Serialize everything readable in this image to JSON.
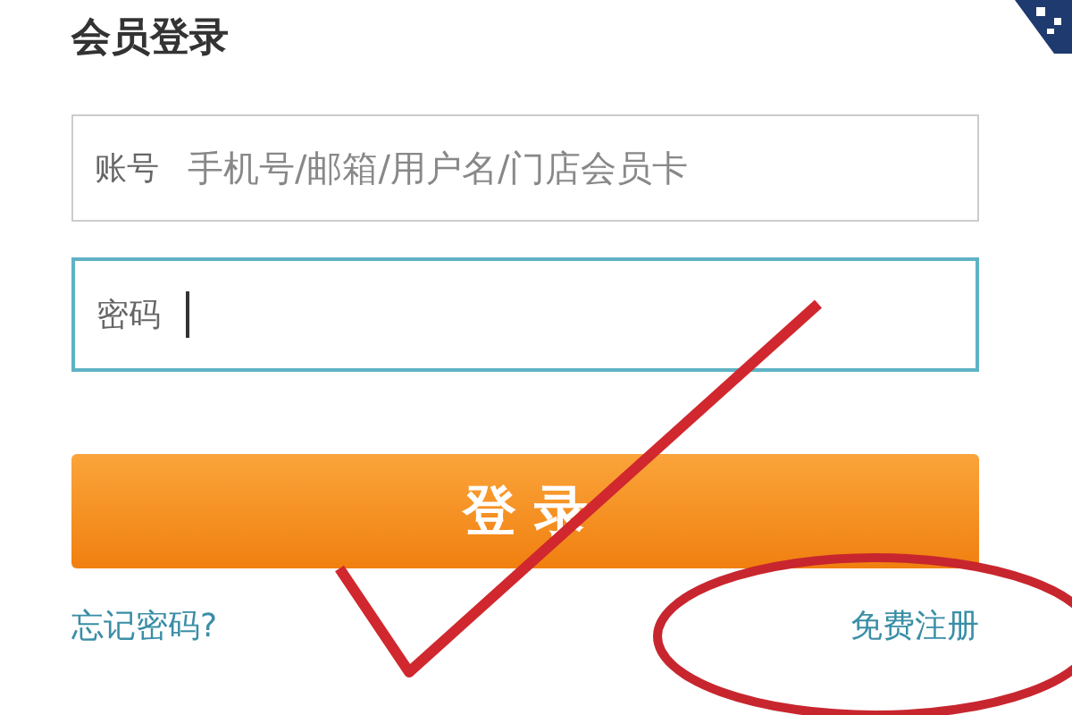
{
  "title": "会员登录",
  "account": {
    "label": "账号",
    "placeholder": "手机号/邮箱/用户名/门店会员卡"
  },
  "password": {
    "label": "密码",
    "focused": true
  },
  "login_button": "登 录",
  "forgot_link": "忘记密码?",
  "register_link": "免费注册"
}
